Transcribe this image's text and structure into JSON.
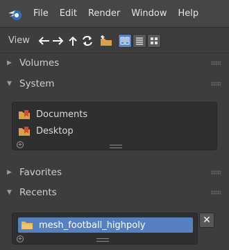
{
  "menubar": {
    "logo": "blender-logo",
    "items": [
      "File",
      "Edit",
      "Render",
      "Window",
      "Help"
    ]
  },
  "toolbar": {
    "view_label": "View",
    "buttons": [
      {
        "name": "back-arrow-icon",
        "glyph": "←"
      },
      {
        "name": "forward-arrow-icon",
        "glyph": "→"
      },
      {
        "name": "parent-dir-icon",
        "glyph": "↑"
      },
      {
        "name": "refresh-icon",
        "glyph": "↻"
      }
    ],
    "new_folder_icon": "new-folder-icon",
    "display_modes": [
      "list-vertical-icon",
      "list-horizontal-icon",
      "thumbnails-icon"
    ]
  },
  "panels": {
    "volumes": {
      "label": "Volumes",
      "expanded": false
    },
    "system": {
      "label": "System",
      "expanded": true,
      "items": [
        "Documents",
        "Desktop"
      ]
    },
    "favorites": {
      "label": "Favorites",
      "expanded": false
    },
    "recents": {
      "label": "Recents",
      "expanded": true,
      "items": [
        "mesh_football_highpoly"
      ]
    }
  },
  "icons": {
    "collapsed": "▶",
    "expanded": "▼",
    "close": "✕",
    "add": "+"
  },
  "colors": {
    "accent": "#5680c2",
    "folder": "#d9a24a",
    "bookmark": "#d24a2f"
  }
}
